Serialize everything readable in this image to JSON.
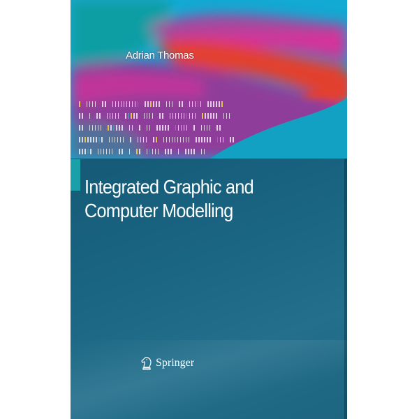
{
  "book": {
    "author": "Adrian Thomas",
    "title_line1": "Integrated Graphic and",
    "title_line2": "Computer Modelling",
    "publisher": "Springer",
    "publisher_logo_icon": "knight-horse-icon"
  },
  "colors": {
    "panel": "#1b6784",
    "accent_bar": "#1b9fa8",
    "sky": "#12a9d3",
    "magenta": "#d6309a",
    "purple": "#8f3c9a",
    "red": "#e2402f",
    "teal": "#0f9ea4"
  },
  "pattern_rows": [
    "| |||| || |||||||||| |||||| ||| || ||||| ||||||",
    "|| | || ||||| ||||| |||| || |||||||||| |||||| |||",
    "|| ||||| |||||| || | || ||||| ||||| | |||| ||",
    "||||||||| |||||| | |||| || |||||||||| |||||| ||| ||",
    "||||| |||||| || | || ||||| ||| | |||| ||"
  ]
}
